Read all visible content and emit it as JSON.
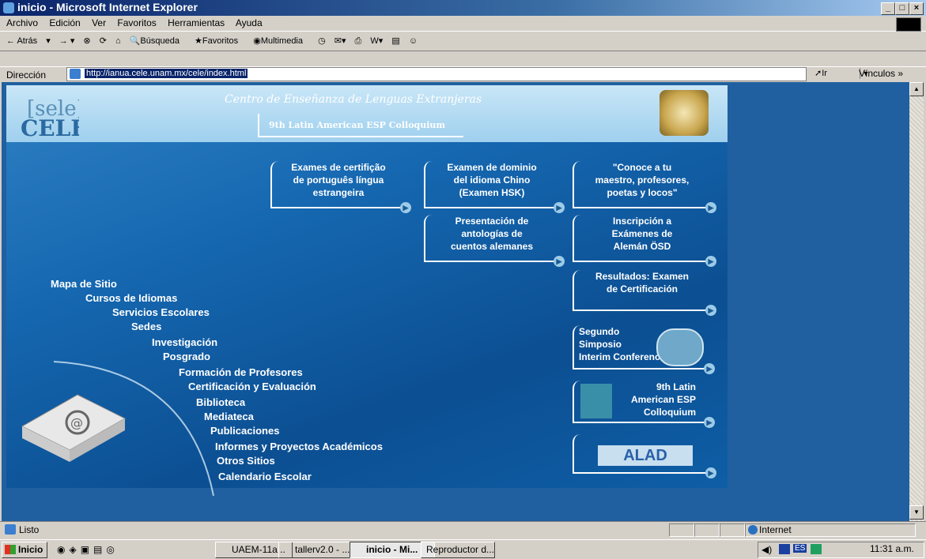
{
  "window": {
    "title": "inicio - Microsoft Internet Explorer"
  },
  "menu": [
    "Archivo",
    "Edición",
    "Ver",
    "Favoritos",
    "Herramientas",
    "Ayuda"
  ],
  "toolbar": {
    "back": "Atrás",
    "search": "Búsqueda",
    "favorites": "Favoritos",
    "multimedia": "Multimedia"
  },
  "address": {
    "label": "Dirección",
    "url": "http://ianua.cele.unam.mx/cele/index.html",
    "go": "Ir",
    "links": "Vínculos"
  },
  "site": {
    "logo_text": "[sele] CELE",
    "tagline": "Centro de Enseñanza de Lenguas Extranjeras",
    "header_link": "9th Latin American ESP Colloquium",
    "promos": [
      {
        "lines": [
          "Exames de certifição",
          "de português língua",
          "estrangeira"
        ]
      },
      {
        "lines": [
          "Examen de dominio",
          "del idioma Chino",
          "(Examen HSK)"
        ]
      },
      {
        "lines": [
          "\"Conoce a tu",
          "maestro, profesores,",
          "poetas y locos\""
        ]
      },
      {
        "lines": [
          "Presentación de",
          "antologías de",
          "cuentos alemanes"
        ]
      },
      {
        "lines": [
          "Inscripción a",
          "Exámenes de",
          "Alemán ÖSD"
        ]
      },
      {
        "lines": [
          "Resultados: Examen",
          "de Certificación"
        ]
      },
      {
        "lines": [
          "Segundo",
          "Simposio",
          "Interim Conference"
        ]
      },
      {
        "lines": [
          "9th Latin",
          "American ESP",
          "Colloquium"
        ]
      },
      {
        "lines": [
          "ALAD"
        ]
      }
    ],
    "nav": [
      "Mapa de Sitio",
      "Cursos de Idiomas",
      "Servicios Escolares",
      "Sedes",
      "Investigación",
      "Posgrado",
      "Formación de Profesores",
      "Certificación y Evaluación",
      "Biblioteca",
      "Mediateca",
      "Publicaciones",
      "Informes y Proyectos Académicos",
      "Otros Sitios",
      "Calendario Escolar"
    ]
  },
  "status": {
    "text": "Listo",
    "zone": "Internet"
  },
  "taskbar": {
    "start": "Inicio",
    "tasks": [
      "UAEM-11a...",
      "tallerv2.0 - ...",
      "inicio - Mi...",
      "Reproductor d..."
    ],
    "lang": "ES",
    "clock": "11:31 a.m."
  }
}
